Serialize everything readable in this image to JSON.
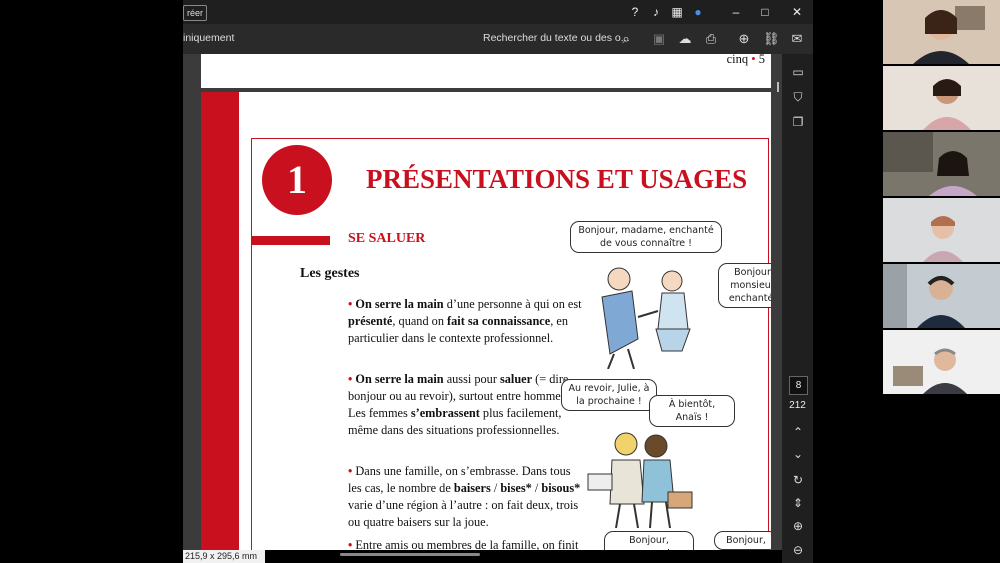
{
  "titlebar": {
    "button_label": "réer",
    "help_icon": "help-icon",
    "bell_icon": "bell-icon"
  },
  "toolbar": {
    "mode_label": "iniquement",
    "search_placeholder": "Rechercher du texte ou des o..."
  },
  "pages": {
    "prev_page_footer": "cinq",
    "prev_page_number": "5"
  },
  "chapter": {
    "number": "1",
    "title": "PRÉSENTATIONS ET USAGES",
    "section_title": "SE SALUER",
    "subtitle": "Les gestes"
  },
  "paragraphs": [
    {
      "bullet": "•",
      "segments": [
        {
          "b": true,
          "t": "On serre la main"
        },
        {
          "b": false,
          "t": " d’une personne à qui on est "
        },
        {
          "b": true,
          "t": "présenté"
        },
        {
          "b": false,
          "t": ", quand on "
        },
        {
          "b": true,
          "t": "fait sa connaissance"
        },
        {
          "b": false,
          "t": ", en particulier dans le contexte professionnel."
        }
      ]
    },
    {
      "bullet": "•",
      "segments": [
        {
          "b": true,
          "t": "On serre la main"
        },
        {
          "b": false,
          "t": " aussi pour "
        },
        {
          "b": true,
          "t": "saluer"
        },
        {
          "b": false,
          "t": " (= dire bonjour ou au revoir), surtout entre hommes. Les femmes "
        },
        {
          "b": true,
          "t": "s’embrassent"
        },
        {
          "b": false,
          "t": " plus facilement, même dans des situations professionnelles."
        }
      ]
    },
    {
      "bullet": "•",
      "segments": [
        {
          "b": false,
          "t": "Dans une famille, on s’embrasse. Dans tous les cas, le nombre de "
        },
        {
          "b": true,
          "t": "baisers"
        },
        {
          "b": false,
          "t": " / "
        },
        {
          "b": true,
          "t": "bises*"
        },
        {
          "b": false,
          "t": " / "
        },
        {
          "b": true,
          "t": "bisous*"
        },
        {
          "b": false,
          "t": " varie d’une région à l’autre : on fait deux, trois ou quatre baisers sur la joue."
        }
      ]
    },
    {
      "bullet": "•",
      "segments": [
        {
          "b": false,
          "t": "Entre amis ou membres de la famille, on finit"
        }
      ]
    }
  ],
  "bubbles": {
    "b1": "Bonjour, madame, enchanté de vous connaître !",
    "b2": "Bonjour, monsieur, enchantée",
    "b3": "Au revoir, Julie, à la prochaine !",
    "b4": "À bientôt, Anaïs !",
    "b5": "Bonjour, maman !",
    "b6": "Bonjour,"
  },
  "navigation": {
    "current_page": "8",
    "total_pages": "212"
  },
  "status": {
    "page_size": "215,9 x 295,6 mm"
  },
  "colors": {
    "accent_red": "#c8101e"
  }
}
